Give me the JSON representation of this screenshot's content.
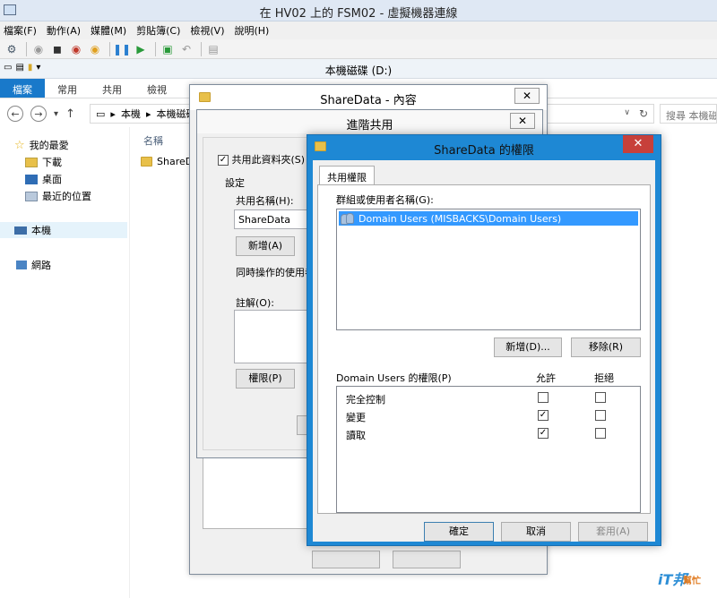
{
  "vm_window": {
    "title": "在 HV02 上的 FSM02 - 虛擬機器連線",
    "menu": [
      "檔案(F)",
      "動作(A)",
      "媒體(M)",
      "剪貼簿(C)",
      "檢視(V)",
      "說明(H)"
    ]
  },
  "explorer": {
    "title": "本機磁碟 (D:)",
    "ribbon_tabs": [
      "檔案",
      "常用",
      "共用",
      "檢視"
    ],
    "breadcrumb": [
      "本機",
      "本機磁碟"
    ],
    "search_placeholder": "搜尋 本機磁碟",
    "nav": {
      "favorites": "我的最愛",
      "downloads": "下載",
      "desktop": "桌面",
      "recent": "最近的位置",
      "this_pc": "本機",
      "network": "網路"
    },
    "column_name": "名稱",
    "file_name": "ShareData"
  },
  "properties_dialog": {
    "title": "ShareData - 內容"
  },
  "advanced_sharing": {
    "title": "進階共用",
    "share_checkbox_label": "共用此資料夾(S)",
    "share_checked": true,
    "settings_label": "設定",
    "share_name_label": "共用名稱(H):",
    "share_name_value": "ShareData",
    "add_button": "新增(A)",
    "limit_users_label": "同時操作的使用者",
    "comment_label": "註解(O):",
    "permissions_button": "權限(P)"
  },
  "permissions_dialog": {
    "title": "ShareData 的權限",
    "tab": "共用權限",
    "group_label": "群組或使用者名稱(G):",
    "users": [
      "Domain Users (MISBACKS\\Domain Users)"
    ],
    "add_button": "新增(D)...",
    "remove_button": "移除(R)",
    "perm_label": "Domain Users 的權限(P)",
    "allow_header": "允許",
    "deny_header": "拒絕",
    "permissions": [
      {
        "name": "完全控制",
        "allow": false,
        "deny": false
      },
      {
        "name": "變更",
        "allow": true,
        "deny": false
      },
      {
        "name": "讀取",
        "allow": true,
        "deny": false
      }
    ],
    "ok_button": "確定",
    "cancel_button": "取消",
    "apply_button": "套用(A)"
  },
  "watermark": {
    "logo": "iT邦",
    "sub": "幫忙"
  },
  "colors": {
    "accent": "#1e88d4",
    "file_tab": "#1979ca",
    "close_red": "#c7403a",
    "selection": "#3399ff"
  }
}
